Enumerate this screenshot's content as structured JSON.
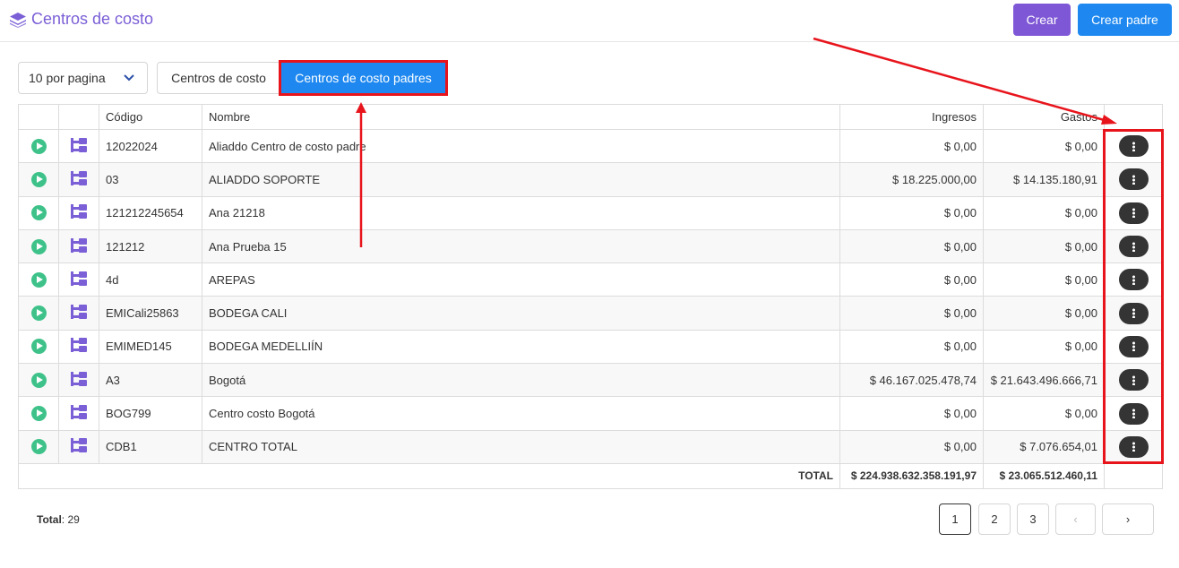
{
  "header": {
    "title": "Centros de costo",
    "title_color": "#7b5fd6",
    "btn_crear": "Crear",
    "btn_crear_padre": "Crear padre"
  },
  "toolbar": {
    "per_page": "10 por pagina",
    "tab_centros": "Centros de costo",
    "tab_padres": "Centros de costo padres"
  },
  "table": {
    "columns": [
      "",
      "",
      "Código",
      "Nombre",
      "Ingresos",
      "Gastos",
      ""
    ],
    "rows": [
      {
        "codigo": "12022024",
        "nombre": "Aliaddo Centro de costo padre",
        "ingresos": "$ 0,00",
        "gastos": "$ 0,00"
      },
      {
        "codigo": "03",
        "nombre": "ALIADDO SOPORTE",
        "ingresos": "$ 18.225.000,00",
        "gastos": "$ 14.135.180,91"
      },
      {
        "codigo": "121212245654",
        "nombre": "Ana 21218",
        "ingresos": "$ 0,00",
        "gastos": "$ 0,00"
      },
      {
        "codigo": "121212",
        "nombre": "Ana Prueba 15",
        "ingresos": "$ 0,00",
        "gastos": "$ 0,00"
      },
      {
        "codigo": "4d",
        "nombre": "AREPAS",
        "ingresos": "$ 0,00",
        "gastos": "$ 0,00"
      },
      {
        "codigo": "EMICali25863",
        "nombre": "BODEGA CALI",
        "ingresos": "$ 0,00",
        "gastos": "$ 0,00"
      },
      {
        "codigo": "EMIMED145",
        "nombre": "BODEGA MEDELLIÍN",
        "ingresos": "$ 0,00",
        "gastos": "$ 0,00"
      },
      {
        "codigo": "A3",
        "nombre": "Bogotá",
        "ingresos": "$ 46.167.025.478,74",
        "gastos": "$ 21.643.496.666,71"
      },
      {
        "codigo": "BOG799",
        "nombre": "Centro costo Bogotá",
        "ingresos": "$ 0,00",
        "gastos": "$ 0,00"
      },
      {
        "codigo": "CDB1",
        "nombre": "CENTRO TOTAL",
        "ingresos": "$ 0,00",
        "gastos": "$ 7.076.654,01"
      }
    ],
    "footer": {
      "label": "TOTAL",
      "ingresos": "$ 224.938.632.358.191,97",
      "gastos": "$ 23.065.512.460,11"
    }
  },
  "footer": {
    "total_label": "Total",
    "total_value": ": 29",
    "pages": [
      "1",
      "2",
      "3"
    ],
    "prev": "‹",
    "next": "›"
  },
  "colors": {
    "primary": "#1e88f0",
    "purple": "#7e57d6",
    "highlight": "#e8141c",
    "play": "#3ec28a"
  }
}
